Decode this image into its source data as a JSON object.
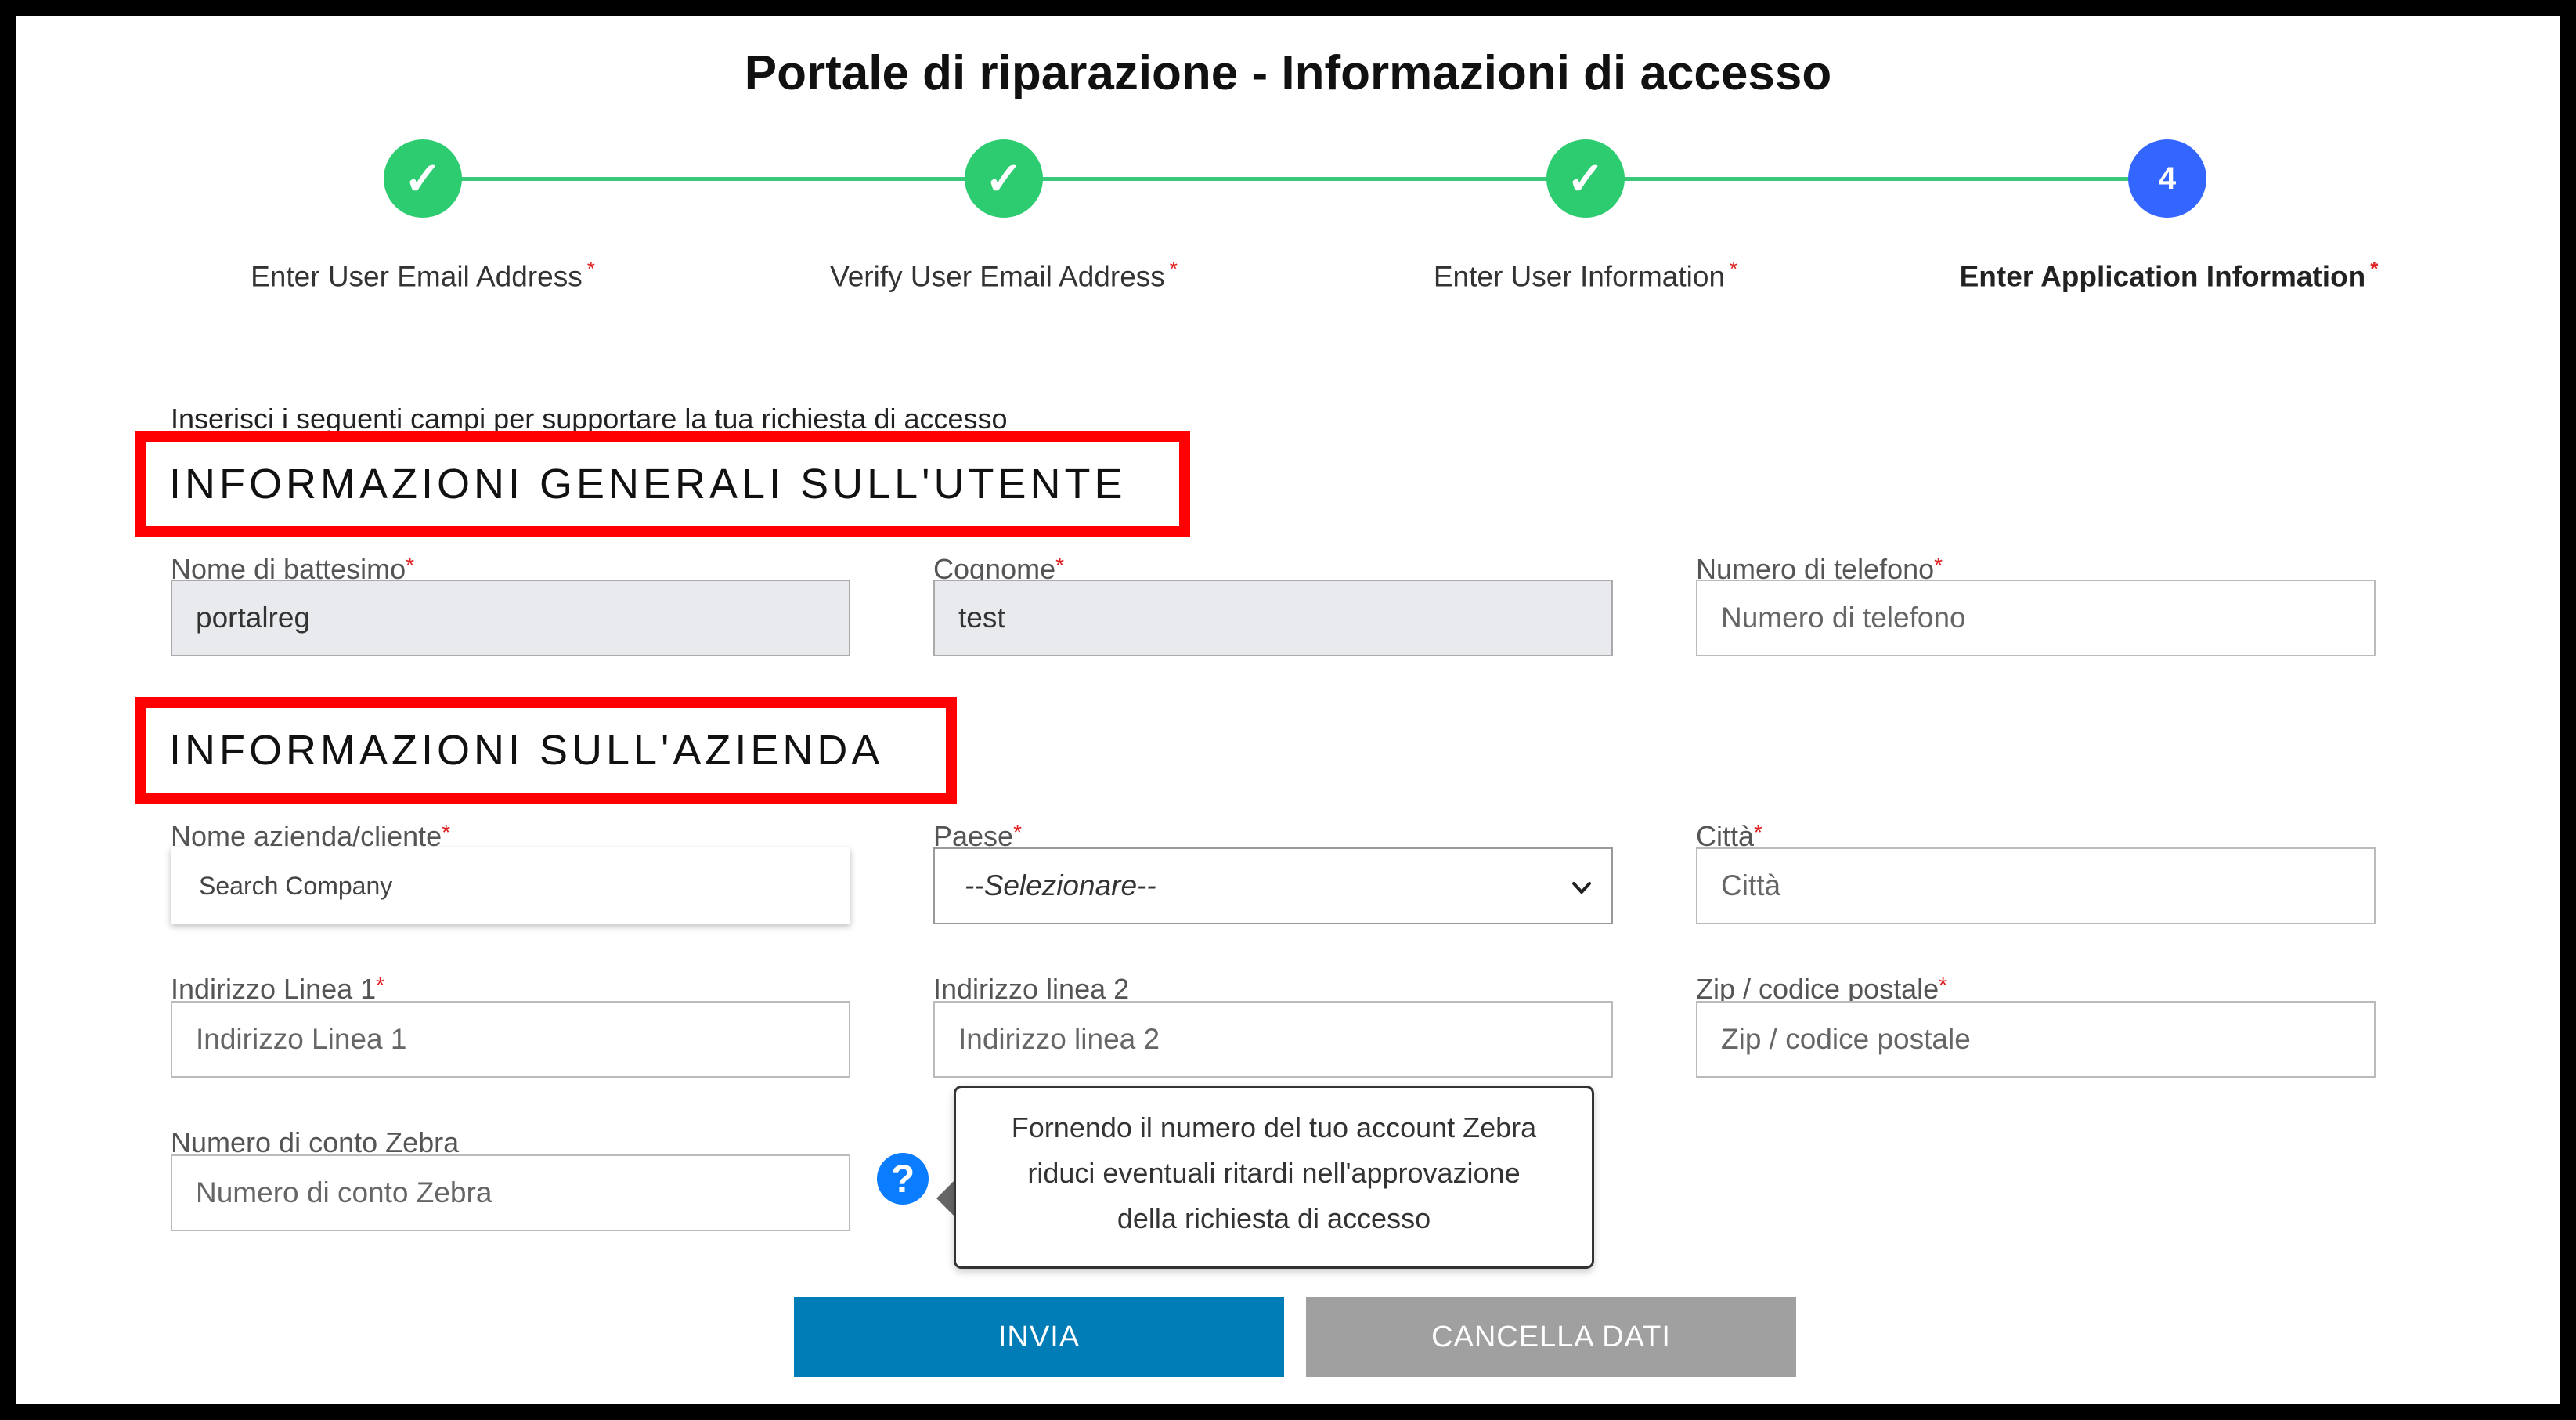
{
  "page": {
    "title": "Portale di riparazione - Informazioni di accesso"
  },
  "stepper": {
    "steps": [
      {
        "label": "Enter User Email Address",
        "marker": "✓",
        "status": "done"
      },
      {
        "label": "Verify User Email Address",
        "marker": "✓",
        "status": "done"
      },
      {
        "label": "Enter User Information",
        "marker": "✓",
        "status": "done"
      },
      {
        "label": "Enter Application Information",
        "marker": "4",
        "status": "current"
      }
    ],
    "required_mark": "*"
  },
  "intro": "Inserisci i seguenti campi per supportare la tua richiesta di accesso",
  "sections": {
    "user": {
      "title": "INFORMAZIONI GENERALI SULL'UTENTE",
      "first_name": {
        "label": "Nome di battesimo",
        "value": "portalreg"
      },
      "last_name": {
        "label": "Cognome",
        "value": "test"
      },
      "phone": {
        "label": "Numero di telefono",
        "placeholder": "Numero di telefono"
      }
    },
    "company": {
      "title": "INFORMAZIONI SULL'AZIENDA",
      "company_name": {
        "label": "Nome azienda/cliente",
        "placeholder": "Search Company"
      },
      "country": {
        "label": "Paese",
        "selected": "--Selezionare--"
      },
      "city": {
        "label": "Città",
        "placeholder": "Città"
      },
      "address1": {
        "label": "Indirizzo Linea 1",
        "placeholder": "Indirizzo Linea 1"
      },
      "address2": {
        "label": "Indirizzo linea 2",
        "placeholder": "Indirizzo linea 2"
      },
      "zip": {
        "label": "Zip / codice postale",
        "placeholder": "Zip / codice postale"
      },
      "account": {
        "label": "Numero di conto Zebra",
        "placeholder": "Numero di conto Zebra"
      }
    }
  },
  "help": {
    "icon": "question-circle-icon",
    "glyph": "?",
    "tooltip_lines": [
      "Fornendo il numero del tuo account Zebra",
      "riduci eventuali ritardi nell'approvazione",
      "della richiesta di accesso"
    ]
  },
  "buttons": {
    "submit": "INVIA",
    "clear": "CANCELLA DATI"
  },
  "colors": {
    "step_done": "#2ecc71",
    "step_current": "#3366ff",
    "highlight_box": "#ff0000",
    "primary_button": "#007cb6",
    "secondary_button": "#a0a0a0"
  }
}
